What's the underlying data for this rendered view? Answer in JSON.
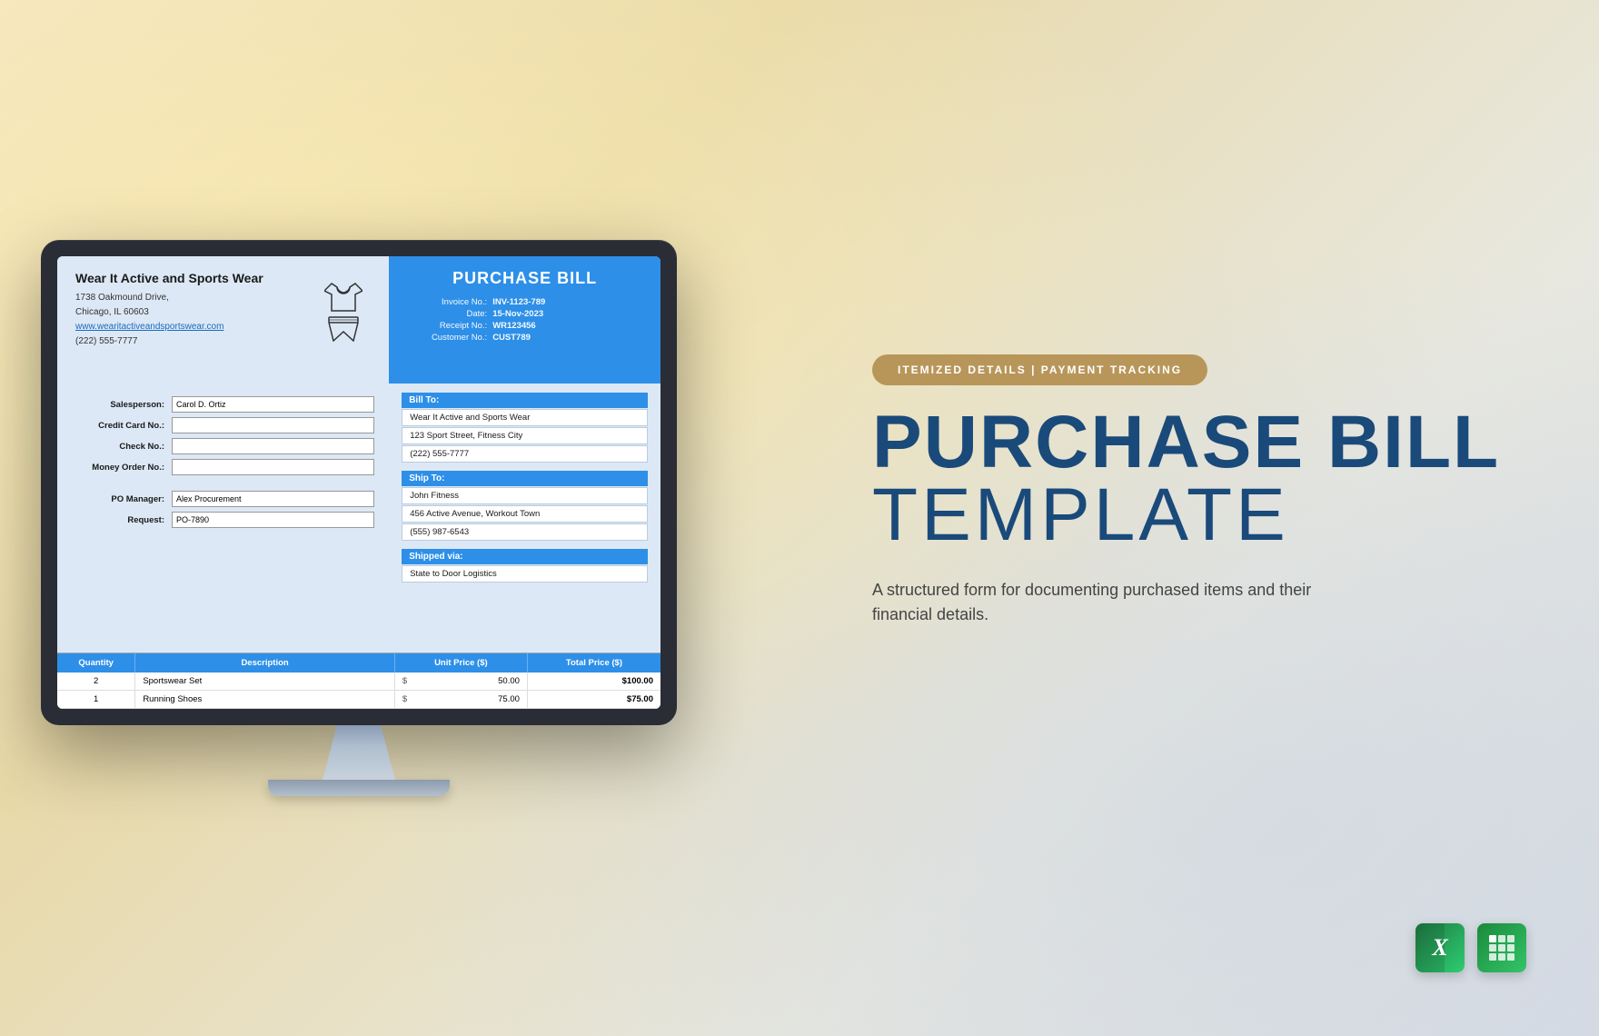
{
  "page": {
    "background": "crumpled paper warm",
    "badge": {
      "text": "ITEMIZED DETAILS  |  PAYMENT TRACKING"
    },
    "title_line1": "PURCHASE BILL",
    "title_line2": "TEMPLATE",
    "subtitle": "A structured form for documenting purchased items and their financial details."
  },
  "monitor": {
    "label": "monitor"
  },
  "invoice": {
    "header": {
      "company_name": "Wear It Active and Sports Wear",
      "address_line1": "1738 Oakmound Drive,",
      "address_line2": "Chicago, IL 60603",
      "website": "www.wearitactiveandsportswear.com",
      "phone": "(222) 555-7777",
      "title": "PURCHASE BILL",
      "invoice_no_label": "Invoice No.:",
      "invoice_no_value": "INV-1123-789",
      "date_label": "Date:",
      "date_value": "15-Nov-2023",
      "receipt_no_label": "Receipt No.:",
      "receipt_no_value": "WR123456",
      "customer_no_label": "Customer No.:",
      "customer_no_value": "CUST789"
    },
    "fields": {
      "salesperson_label": "Salesperson:",
      "salesperson_value": "Carol D. Ortiz",
      "credit_card_label": "Credit Card No.:",
      "credit_card_value": "",
      "check_label": "Check No.:",
      "check_value": "",
      "money_order_label": "Money Order No.:",
      "money_order_value": "",
      "po_manager_label": "PO Manager:",
      "po_manager_value": "Alex Procurement",
      "request_label": "Request:",
      "request_value": "PO-7890"
    },
    "bill_to": {
      "header": "Bill To:",
      "line1": "Wear It Active and Sports Wear",
      "line2": "123 Sport Street, Fitness City",
      "line3": "(222) 555-7777"
    },
    "ship_to": {
      "header": "Ship To:",
      "line1": "John Fitness",
      "line2": "456 Active Avenue, Workout Town",
      "line3": "(555) 987-6543"
    },
    "shipped_via": {
      "header": "Shipped via:",
      "value": "State to Door Logistics"
    },
    "table": {
      "columns": [
        "Quantity",
        "Description",
        "Unit Price ($)",
        "Total  Price ($)"
      ],
      "rows": [
        {
          "qty": "2",
          "desc": "Sportswear Set",
          "unit_dollar": "$",
          "unit_price": "50.00",
          "total": "$100.00"
        },
        {
          "qty": "1",
          "desc": "Running Shoes",
          "unit_dollar": "$",
          "unit_price": "75.00",
          "total": "$75.00"
        }
      ]
    }
  },
  "app_icons": {
    "excel_letter": "X",
    "excel_label": "Microsoft Excel",
    "sheets_label": "Google Sheets"
  }
}
